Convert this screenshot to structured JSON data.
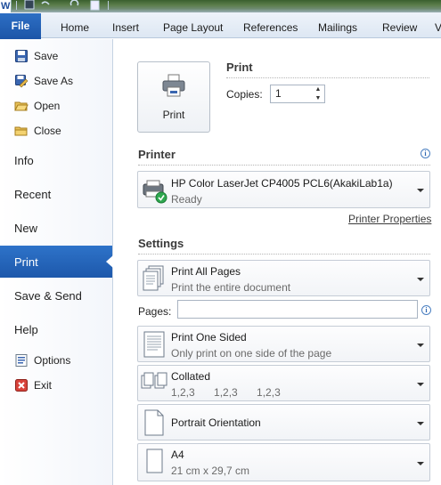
{
  "app": {
    "logo_letter": "W"
  },
  "ribbon": {
    "file_label": "File",
    "tabs": [
      "Home",
      "Insert",
      "Page Layout",
      "References",
      "Mailings",
      "Review",
      "V"
    ]
  },
  "nav": {
    "small_top": [
      {
        "label": "Save",
        "icon": "save-icon"
      },
      {
        "label": "Save As",
        "icon": "save-as-icon"
      },
      {
        "label": "Open",
        "icon": "open-folder-icon"
      },
      {
        "label": "Close",
        "icon": "close-folder-icon"
      }
    ],
    "big": [
      "Info",
      "Recent",
      "New",
      "Print",
      "Save & Send",
      "Help"
    ],
    "active": "Print",
    "small_bottom": [
      {
        "label": "Options",
        "icon": "options-icon"
      },
      {
        "label": "Exit",
        "icon": "exit-icon"
      }
    ]
  },
  "print": {
    "section_title": "Print",
    "button_label": "Print",
    "copies_label": "Copies:",
    "copies_value": "1"
  },
  "printer": {
    "section_title": "Printer",
    "name": "HP Color LaserJet CP4005 PCL6(AkakiLab1a)",
    "status": "Ready",
    "properties_link": "Printer Properties"
  },
  "settings": {
    "section_title": "Settings",
    "print_pages": {
      "title": "Print All Pages",
      "subtitle": "Print the entire document"
    },
    "pages_label": "Pages:",
    "pages_value": "",
    "sided": {
      "title": "Print One Sided",
      "subtitle": "Only print on one side of the page"
    },
    "collate": {
      "title": "Collated",
      "subtitle": "1,2,3    1,2,3    1,2,3"
    },
    "orientation": {
      "title": "Portrait Orientation"
    },
    "paper": {
      "title": "A4",
      "subtitle": "21 cm x 29,7 cm"
    }
  },
  "colors": {
    "accent": "#1d58ab",
    "active_nav": "#2e73c9",
    "ready_check": "#2fa84f"
  }
}
